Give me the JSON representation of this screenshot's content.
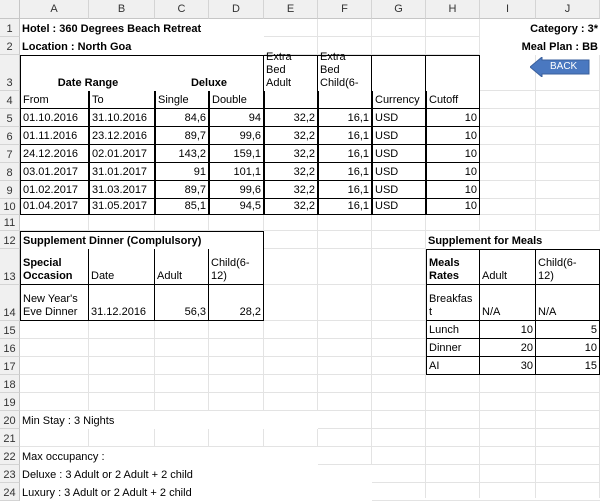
{
  "columns": [
    "A",
    "B",
    "C",
    "D",
    "E",
    "F",
    "G",
    "H",
    "I",
    "J"
  ],
  "rows": [
    "1",
    "2",
    "3",
    "4",
    "5",
    "6",
    "7",
    "8",
    "9",
    "10",
    "11",
    "12",
    "13",
    "14",
    "15",
    "16",
    "17",
    "18",
    "19",
    "20",
    "21",
    "22",
    "23",
    "24"
  ],
  "hotel": "Hotel : 360 Degrees Beach Retreat",
  "location": "Location : North Goa",
  "category": "Category : 3*",
  "meal_plan": "Meal Plan : BB",
  "back_button": "BACK",
  "rate_table": {
    "date_range": "Date Range",
    "deluxe": "Deluxe",
    "extra_bed_adult": [
      "Extra",
      "Bed",
      "Adult"
    ],
    "extra_bed_child": [
      "Extra",
      "Bed",
      "Child(6-"
    ],
    "from": "From",
    "to": "To",
    "single": "Single",
    "double": "Double",
    "currency": "Currency",
    "cutoff": "Cutoff",
    "rows": [
      [
        "01.10.2016",
        "31.10.2016",
        "84,6",
        "94",
        "32,2",
        "16,1",
        "USD",
        "10"
      ],
      [
        "01.11.2016",
        "23.12.2016",
        "89,7",
        "99,6",
        "32,2",
        "16,1",
        "USD",
        "10"
      ],
      [
        "24.12.2016",
        "02.01.2017",
        "143,2",
        "159,1",
        "32,2",
        "16,1",
        "USD",
        "10"
      ],
      [
        "03.01.2017",
        "31.01.2017",
        "91",
        "101,1",
        "32,2",
        "16,1",
        "USD",
        "10"
      ],
      [
        "01.02.2017",
        "31.03.2017",
        "89,7",
        "99,6",
        "32,2",
        "16,1",
        "USD",
        "10"
      ],
      [
        "01.04.2017",
        "31.05.2017",
        "85,1",
        "94,5",
        "32,2",
        "16,1",
        "USD",
        "10"
      ]
    ]
  },
  "supplement_dinner": {
    "title": "Supplement Dinner (Complulsory)",
    "special": "Special",
    "occasion": "Occasion",
    "date": "Date",
    "adult": "Adult",
    "child": [
      "Child(6-",
      "12)"
    ],
    "event": [
      "New Year's",
      "Eve Dinner"
    ],
    "event_date": "31.12.2016",
    "event_adult": "56,3",
    "event_child": "28,2"
  },
  "supplement_meals": {
    "title": "Supplement for Meals",
    "meals": "Meals",
    "rates": "Rates",
    "adult": "Adult",
    "child": [
      "Child(6-",
      "12)"
    ],
    "breakfast": [
      "Breakfas",
      "t"
    ],
    "breakfast_adult": "N/A",
    "breakfast_child": "N/A",
    "rows": [
      [
        "Lunch",
        "10",
        "5"
      ],
      [
        "Dinner",
        "20",
        "10"
      ],
      [
        "AI",
        "30",
        "15"
      ]
    ]
  },
  "min_stay": "Min Stay : 3 Nights",
  "max_occupancy": "Max occupancy :",
  "deluxe_occupancy": "Deluxe : 3 Adult or 2 Adult + 2 child",
  "luxury_occupancy": "Luxury : 3 Adult or 2 Adult + 2 child",
  "colors": {
    "header_bg": "#f0f0f0",
    "gridline": "#e3e3e3",
    "back_button": "#4a78c0"
  }
}
